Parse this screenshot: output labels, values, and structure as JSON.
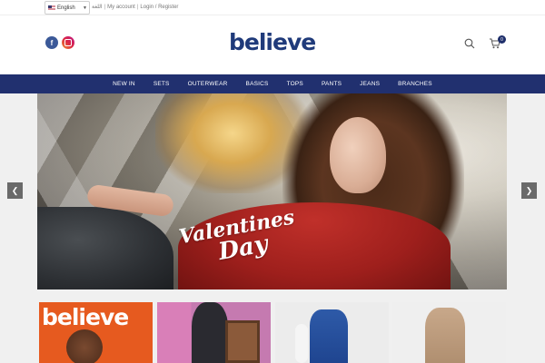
{
  "topbar": {
    "language": "English",
    "links": {
      "arabic": "اللغة",
      "my_account": "My account",
      "login": "Login / Register"
    }
  },
  "header": {
    "logo": "believe",
    "cart_count": "0"
  },
  "nav": {
    "items": [
      "NEW IN",
      "SETS",
      "OUTERWEAR",
      "BASICS",
      "TOPS",
      "PANTS",
      "JEANS",
      "BRANCHES"
    ]
  },
  "hero": {
    "line1": "Valentines",
    "line2": "Day"
  },
  "tiles": {
    "tile1_logo": "believe"
  },
  "colors": {
    "nav_bg": "#21306f",
    "logo": "#1f3a7a",
    "facebook": "#3b5998"
  },
  "icons": {
    "search": "search-icon",
    "cart": "cart-icon",
    "prev": "chevron-left-icon",
    "next": "chevron-right-icon"
  }
}
